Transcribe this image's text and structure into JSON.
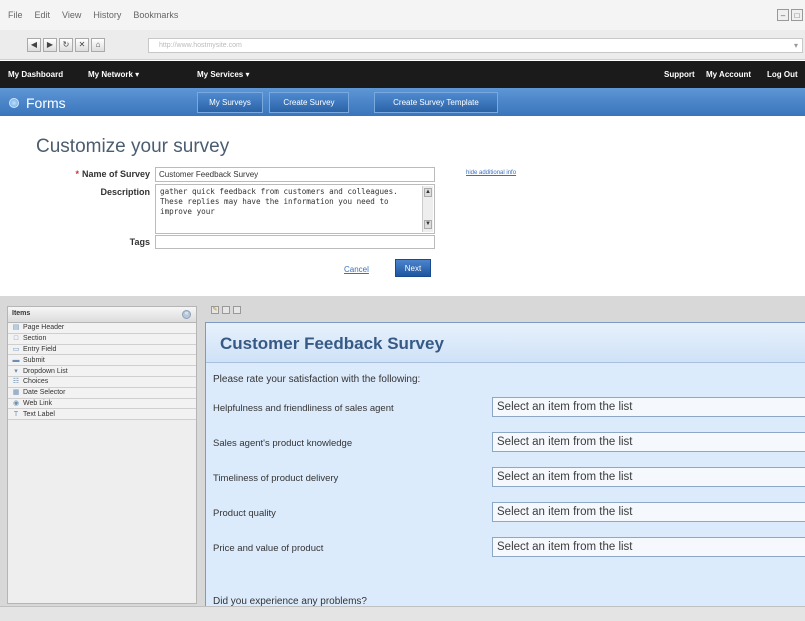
{
  "browser": {
    "menu": [
      "File",
      "Edit",
      "View",
      "History",
      "Bookmarks"
    ],
    "address": "http://www.hostmysite.com"
  },
  "topnav": {
    "dashboard": "My Dashboard",
    "network": "My Network ▾",
    "services": "My Services ▾",
    "support": "Support",
    "account": "My Account",
    "logout": "Log Out"
  },
  "section": {
    "title": "Forms",
    "tabs": [
      "My Surveys",
      "Create Survey",
      "Create Survey Template"
    ]
  },
  "customize": {
    "title": "Customize your survey",
    "name_label": "Name of Survey",
    "name_value": "Customer Feedback Survey",
    "hide_link": "hide additional info",
    "desc_label": "Description",
    "desc_value": "gather quick feedback from customers and colleagues. These replies may have the information you need to improve your",
    "tags_label": "Tags",
    "cancel": "Cancel",
    "next": "Next"
  },
  "items": {
    "title": "Items",
    "list": [
      {
        "label": "Page Header",
        "icon": "page-header-icon"
      },
      {
        "label": "Section",
        "icon": "section-icon"
      },
      {
        "label": "Entry Field",
        "icon": "entry-field-icon"
      },
      {
        "label": "Submit",
        "icon": "submit-icon"
      },
      {
        "label": "Dropdown List",
        "icon": "dropdown-list-icon"
      },
      {
        "label": "Choices",
        "icon": "choices-icon"
      },
      {
        "label": "Date Selector",
        "icon": "date-selector-icon"
      },
      {
        "label": "Web Link",
        "icon": "web-link-icon"
      },
      {
        "label": "Text Label",
        "icon": "text-label-icon"
      }
    ]
  },
  "survey": {
    "title": "Customer Feedback Survey",
    "intro": "Please rate your satisfaction with the following:",
    "questions": [
      {
        "label": "Helpfulness and friendliness of sales agent",
        "placeholder": "Select an item from the list"
      },
      {
        "label": "Sales agent's product knowledge",
        "placeholder": "Select an item from the list"
      },
      {
        "label": "Timeliness of product delivery",
        "placeholder": "Select an item from the list"
      },
      {
        "label": "Product quality",
        "placeholder": "Select an item from the list"
      },
      {
        "label": "Price and value of product",
        "placeholder": "Select an item from the list"
      }
    ],
    "last_question": "Did you experience any problems?"
  }
}
